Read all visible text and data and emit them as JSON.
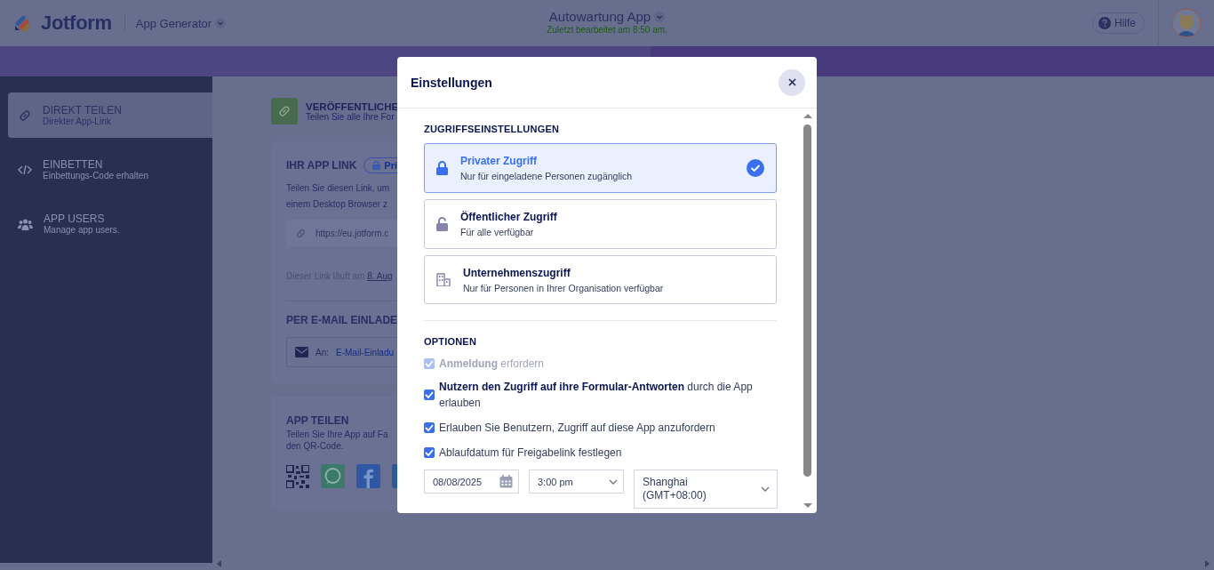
{
  "header": {
    "logo_text": "Jotform",
    "product": "App Generator",
    "app_title": "Autowartung App",
    "last_edited": "Zuletzt bearbeitet am 8:50 am.",
    "help": "Hilfe"
  },
  "sidebar": {
    "items": [
      {
        "title": "DIREKT TEILEN",
        "subtitle": "Direkter App-Link",
        "selected": true,
        "kind": "link"
      },
      {
        "title": "EINBETTEN",
        "subtitle": "Einbettungs-Code erhalten",
        "selected": false,
        "kind": "code"
      },
      {
        "title": "APP USERS",
        "subtitle": "Manage app users.",
        "selected": false,
        "kind": "users"
      }
    ]
  },
  "main": {
    "publish": {
      "title": "VERÖFFENTLICHE",
      "subtitle": "Teilen Sie alle Ihre For"
    },
    "link_card": {
      "title": "IHR APP LINK",
      "badge": "Pri",
      "description": [
        "Teilen Sie diesen Link, um",
        "einem Desktop Browser z"
      ],
      "url": "https://eu.jotform.c",
      "expiry_text": "Dieser Link läuft am",
      "expiry_link": "8. Aug"
    },
    "email": {
      "title": "PER E-MAIL EINLADE",
      "to_label": "An:",
      "placeholder": "E-Mail-Einladu"
    },
    "share": {
      "title": "APP TEILEN",
      "description": [
        "Teilen Sie Ihre App auf Fa",
        "den QR-Code."
      ]
    }
  },
  "dialog": {
    "title": "Einstellungen",
    "access_heading": "ZUGRIFFSEINSTELLUNGEN",
    "access_options": [
      {
        "kind": "lock",
        "title": "Privater Zugriff",
        "description": "Nur für eingeladene Personen zugänglich",
        "selected": true
      },
      {
        "kind": "unlock",
        "title": "Öffentlicher Zugriff",
        "description": "Für alle verfügbar",
        "selected": false
      },
      {
        "kind": "building",
        "title": "Unternehmenszugriff",
        "description": "Nur für Personen in Ihrer Organisation verfügbar",
        "selected": false
      }
    ],
    "options_heading": "OPTIONEN",
    "options": [
      {
        "text": "**Anmeldung** erfordern",
        "checked": true,
        "disabled": true
      },
      {
        "text": "**Nutzern den Zugriff auf ihre Formular-Antworten** durch die App erlauben",
        "checked": true,
        "disabled": false
      },
      {
        "text": "Erlauben Sie Benutzern, Zugriff auf diese App anzufordern",
        "checked": true,
        "disabled": false
      },
      {
        "text": "Ablaufdatum für Freigabelink festlegen",
        "checked": true,
        "disabled": false
      }
    ],
    "date": "08/08/2025",
    "time": "3:00 pm",
    "timezone": "Shanghai (GMT+08:00)"
  }
}
